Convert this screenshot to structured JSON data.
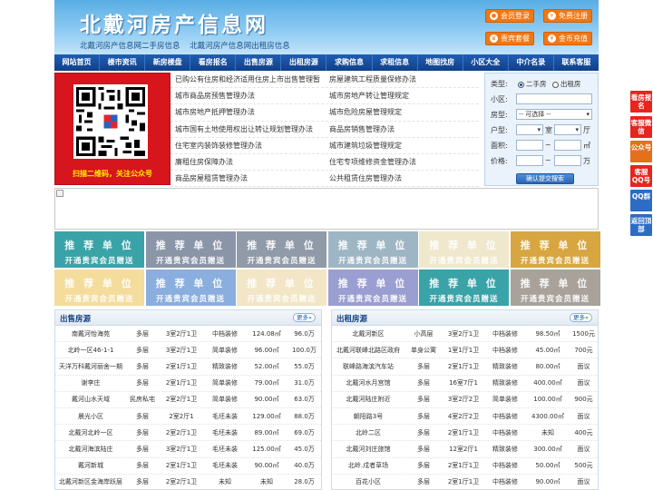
{
  "header": {
    "title": "北戴河房产信息网",
    "subtitle_1": "北戴河房产信息网二手房信息",
    "subtitle_2": "北戴河房产信息网出租房信息",
    "buttons": {
      "login": "会员登录",
      "register": "免费注册",
      "package": "贵宾套餐",
      "recharge": "金币充值"
    }
  },
  "nav": [
    "网站首页",
    "楼市资讯",
    "新房楼盘",
    "看房报名",
    "出售房源",
    "出租房源",
    "求购信息",
    "求租信息",
    "地图找房",
    "小区大全",
    "中介名录",
    "联系客服"
  ],
  "qr": {
    "caption": "扫描二维码，关注公众号"
  },
  "links": [
    [
      "已购公有住房和经济适用住房上市出售管理暂",
      "房屋建筑工程质量保修办法"
    ],
    [
      "城市商品房预售管理办法",
      "城市房地产转让管理规定"
    ],
    [
      "城市房地产抵押管理办法",
      "城市危险房屋管理规定"
    ],
    [
      "城市国有土地使用权出让转让规划管理办法",
      "商品房销售管理办法"
    ],
    [
      "住宅室内装饰装修管理办法",
      "城市建筑垃圾管理规定"
    ],
    [
      "廉租住房保障办法",
      "住宅专项维修资金管理办法"
    ],
    [
      "商品房屋租赁管理办法",
      "公共租赁住房管理办法"
    ]
  ],
  "search": {
    "type_label": "类型:",
    "opt_sale": "二手房",
    "opt_rent": "出租房",
    "district_label": "小区:",
    "house_label": "房型:",
    "house_value": "-- 可选择 --",
    "layout_label": "户型:",
    "room_unit": "室",
    "hall_unit": "厅",
    "area_label": "面积:",
    "area_unit": "㎡",
    "price_label": "价格:",
    "price_unit": "万",
    "tilde": "~",
    "submit": "确认提交搜索"
  },
  "tiles": {
    "line1": "推 荐 单 位",
    "line2": "开通贵宾会员赠送",
    "colors": [
      "#3aa3a8",
      "#8b95a8",
      "#909aa8",
      "#9eb6c4",
      "#f0e8cc",
      "#d7a640",
      "#f4dc9c",
      "#8aaede",
      "#f2e6c6",
      "#9a9ed0",
      "#3aa3a8",
      "#a8a29a"
    ]
  },
  "sale": {
    "title": "出售房源",
    "more": "更多»",
    "rows": [
      [
        "南戴河怡海苑",
        "多层",
        "3室2厅1卫",
        "中档装修",
        "124.08㎡",
        "96.0万"
      ],
      [
        "北岭一区46-1-1",
        "多层",
        "3室2厅1卫",
        "简单装修",
        "96.00㎡",
        "100.0万"
      ],
      [
        "天洋万科戴河丽舍一期",
        "多层",
        "2室1厅1卫",
        "精致装修",
        "52.00㎡",
        "55.0万"
      ],
      [
        "谢李庄",
        "多层",
        "2室1厅1卫",
        "简单装修",
        "79.00㎡",
        "31.0万"
      ],
      [
        "戴河山水天域",
        "民房私宅",
        "2室2厅1卫",
        "简单装修",
        "90.00㎡",
        "63.0万"
      ],
      [
        "晨光小区",
        "多层",
        "2室2厅1",
        "毛坯未装",
        "129.00㎡",
        "88.0万"
      ],
      [
        "北戴河北岭一区",
        "多层",
        "2室2厅1卫",
        "毛坯未装",
        "89.00㎡",
        "69.0万"
      ],
      [
        "北戴河海滨陆庄",
        "多层",
        "3室2厅1卫",
        "毛坯未装",
        "125.00㎡",
        "45.0万"
      ],
      [
        "戴河新城",
        "多层",
        "2室1厅1卫",
        "毛坯未装",
        "90.00㎡",
        "40.0万"
      ],
      [
        "北戴河新区金海岸跃层",
        "多层",
        "2室2厅1卫",
        "未知",
        "未知",
        "28.0万"
      ]
    ]
  },
  "rent": {
    "title": "出租房源",
    "more": "更多»",
    "rows": [
      [
        "北戴河新区",
        "小高层",
        "3室2厅1卫",
        "中档装修",
        "98.50㎡",
        "1500元"
      ],
      [
        "北戴河联峰北路区政府",
        "单身公寓",
        "1室1厅1卫",
        "中档装修",
        "45.00㎡",
        "700元"
      ],
      [
        "联峰路海滨汽车站",
        "多层",
        "2室1厅1卫",
        "精致装修",
        "80.00㎡",
        "面议"
      ],
      [
        "北戴河水月宫馆",
        "多层",
        "16室7厅1",
        "精致装修",
        "400.00㎡",
        "面议"
      ],
      [
        "北戴河陆庄附近",
        "多层",
        "3室2厅2卫",
        "简单装修",
        "100.00㎡",
        "900元"
      ],
      [
        "朝阳路3号",
        "多层",
        "4室2厅2卫",
        "中档装修",
        "4300.00㎡",
        "面议"
      ],
      [
        "北岭二区",
        "多层",
        "2室1厅1卫",
        "中档装修",
        "未知",
        "400元"
      ],
      [
        "北戴河刘庄旅馆",
        "多层",
        "12室2厅1",
        "精致装修",
        "300.00㎡",
        "面议"
      ],
      [
        "北岭.戍者草场",
        "多层",
        "2室1厅1卫",
        "中档装修",
        "50.00㎡",
        "500元"
      ],
      [
        "百花小区",
        "多层",
        "2室1厅1卫",
        "中档装修",
        "90.00㎡",
        "面议"
      ]
    ]
  },
  "float_menu": [
    {
      "label": "看房报名",
      "color": "#e5251e"
    },
    {
      "label": "客服微信",
      "color": "#e5251e"
    },
    {
      "label": "公众号",
      "color": "#e66f1c"
    },
    {
      "label": "客服QQ号",
      "color": "#e5251e"
    },
    {
      "label": "QQ群",
      "color": "#2c6cc4"
    },
    {
      "label": "返回顶部",
      "color": "#2c6cc4"
    }
  ]
}
